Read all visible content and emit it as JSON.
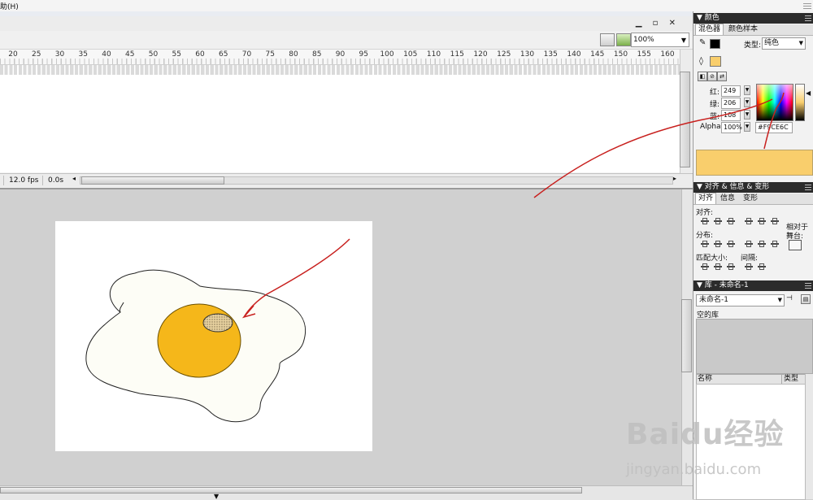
{
  "menu": {
    "help": "助(H)"
  },
  "toolbar": {
    "zoom": "100%"
  },
  "timeline": {
    "ruler_ticks": [
      "20",
      "25",
      "30",
      "35",
      "40",
      "45",
      "50",
      "55",
      "60",
      "65",
      "70",
      "75",
      "80",
      "85",
      "90",
      "95",
      "100",
      "105",
      "110",
      "115",
      "120",
      "125",
      "130",
      "135",
      "140",
      "145",
      "150",
      "155",
      "160"
    ],
    "fps": "12.0 fps",
    "time": "0.0s"
  },
  "color_panel": {
    "title": "颜色",
    "tabs": [
      "混色器",
      "颜色样本"
    ],
    "type_label": "类型:",
    "type_value": "纯色",
    "red_label": "红:",
    "red_value": "249",
    "green_label": "绿:",
    "green_value": "206",
    "blue_label": "蓝:",
    "blue_value": "108",
    "alpha_label": "Alpha:",
    "alpha_value": "100%",
    "hex": "#F9CE6C",
    "current_color": "#F9CE6C"
  },
  "align_panel": {
    "title": "对齐 & 信息 & 变形",
    "tabs": [
      "对齐",
      "信息",
      "变形"
    ],
    "align_label": "对齐:",
    "distribute_label": "分布:",
    "match_size_label": "匹配大小:",
    "spacing_label": "间隔:",
    "relative_label_line1": "相对于",
    "relative_label_line2": "舞台:"
  },
  "library_panel": {
    "title": "库 - 未命名-1",
    "doc_select": "未命名-1",
    "empty_text": "空的库",
    "col_name": "名称",
    "col_type": "类型"
  },
  "artwork": {
    "egg_white_color": "#fdfdf6",
    "yolk_color": "#f5b71a",
    "arrow_color": "#c8201e"
  },
  "watermark": {
    "logo": "Baidu经验",
    "url": "jingyan.baidu.com"
  }
}
